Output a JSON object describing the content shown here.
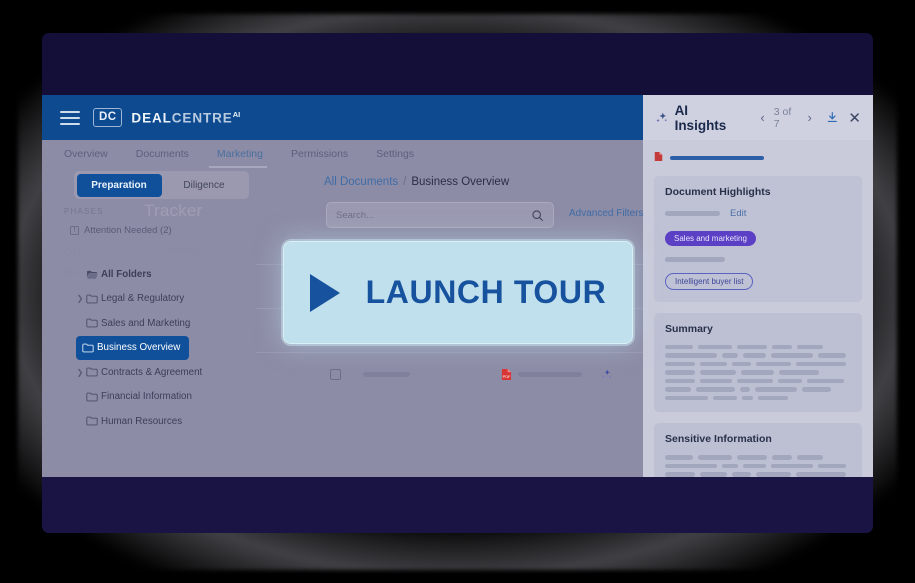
{
  "brand": {
    "badge": "DC",
    "name_bold": "DEAL",
    "name_light": "CENTRE",
    "name_sup": "AI",
    "accent_blue": "#0d4a8f",
    "navy": "#130f38"
  },
  "topnav": {
    "items": [
      {
        "label": "Overview",
        "active": false
      },
      {
        "label": "Documents",
        "active": false
      },
      {
        "label": "Marketing",
        "active": true
      },
      {
        "label": "Permissions",
        "active": false
      },
      {
        "label": "Settings",
        "active": false
      }
    ]
  },
  "sidebar": {
    "segmented": {
      "active": "Preparation",
      "inactive": "Diligence"
    },
    "phases_label": "PHASES",
    "tracker_ghost": "Tracker",
    "attention": {
      "label": "Attention Needed (2)",
      "icon": "!"
    },
    "ghost_cim": "CIM",
    "ghost_company": "Company",
    "ghost_ma": "MA",
    "tree": [
      {
        "label": "All Folders",
        "level": 0,
        "expandable": false,
        "selected": false
      },
      {
        "label": "Legal & Regulatory",
        "level": 1,
        "expandable": true,
        "selected": false
      },
      {
        "label": "Sales and Marketing",
        "level": 1,
        "expandable": false,
        "selected": false
      },
      {
        "label": "Business Overview",
        "level": 1,
        "expandable": false,
        "selected": true
      },
      {
        "label": "Contracts & Agreement",
        "level": 1,
        "expandable": true,
        "selected": false
      },
      {
        "label": "Financial Information",
        "level": 1,
        "expandable": false,
        "selected": false
      },
      {
        "label": "Human Resources",
        "level": 1,
        "expandable": false,
        "selected": false
      }
    ]
  },
  "main": {
    "breadcrumb": {
      "root": "All Documents",
      "separator": "/",
      "current": "Business Overview"
    },
    "search": {
      "value": "",
      "placeholder": "Search...",
      "icon": "search-icon"
    },
    "advanced_filters": "Advanced Filters",
    "rows_count": 3
  },
  "ai_panel": {
    "title": "AI Insights",
    "pagination": {
      "current": "3 of 7",
      "prev": "‹",
      "next": "›"
    },
    "download_icon": "download-icon",
    "close_icon": "close-icon",
    "cards": [
      {
        "title": "Document Highlights",
        "edit_label": "Edit",
        "tags": [
          {
            "label": "Sales and marketing",
            "style": "filled"
          },
          {
            "label": "Intelligent buyer list",
            "style": "outline"
          }
        ]
      },
      {
        "title": "Summary",
        "body_lines": 7
      },
      {
        "title": "Sensitive Information",
        "body_lines": 4
      }
    ]
  },
  "overlay": {
    "button_label": "LAUNCH TOUR",
    "play_icon": "play-icon",
    "background": "#bfe0ec",
    "text_color": "#17529e"
  }
}
